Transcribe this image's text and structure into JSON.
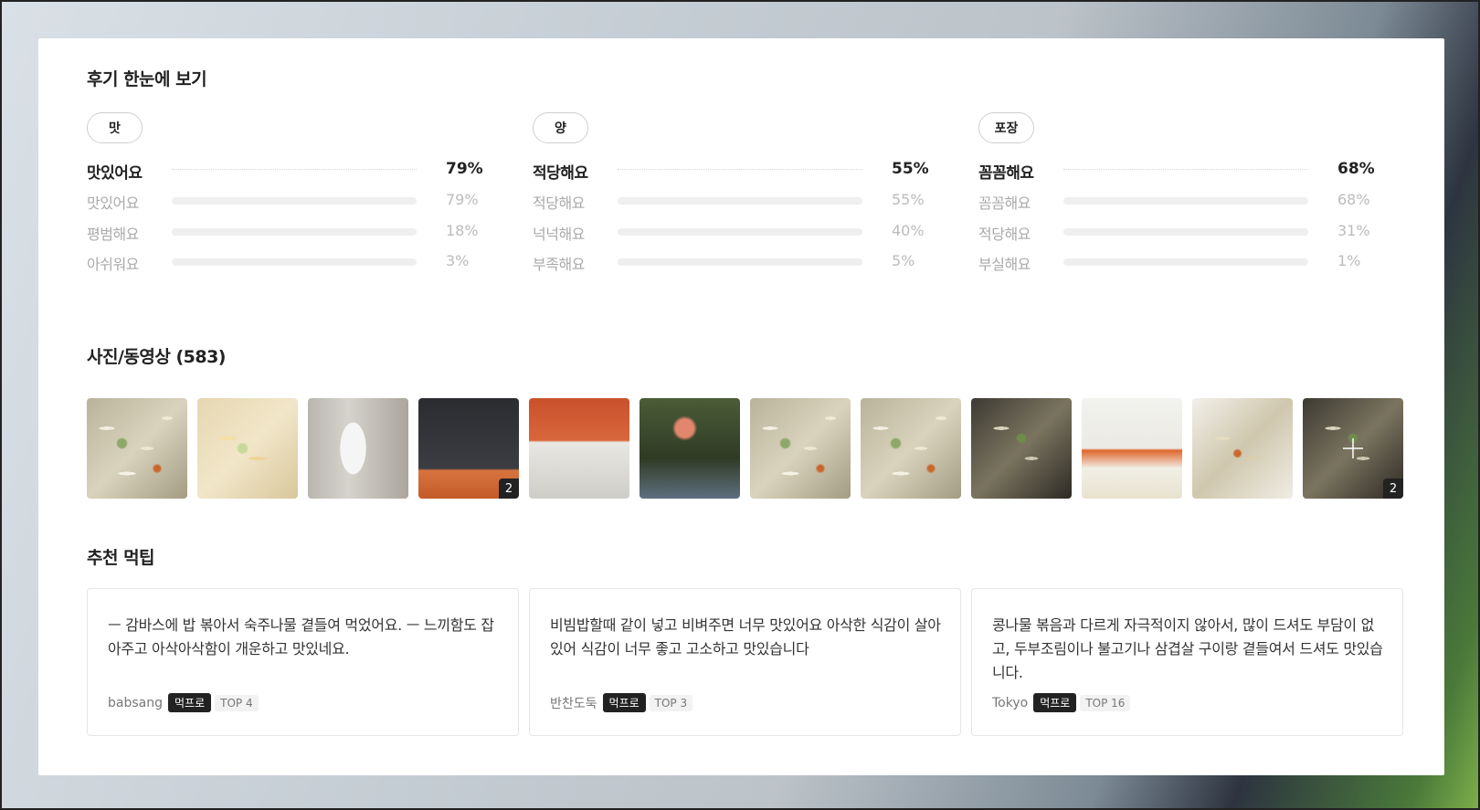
{
  "summary": {
    "title": "후기 한눈에 보기",
    "columns": [
      {
        "pill": "맛",
        "top_label": "맛있어요",
        "top_pct": "79%",
        "rows": [
          {
            "label": "맛있어요",
            "pct": "79%",
            "value": 79
          },
          {
            "label": "평범해요",
            "pct": "18%",
            "value": 18
          },
          {
            "label": "아쉬워요",
            "pct": "3%",
            "value": 3
          }
        ]
      },
      {
        "pill": "양",
        "top_label": "적당해요",
        "top_pct": "55%",
        "rows": [
          {
            "label": "적당해요",
            "pct": "55%",
            "value": 55
          },
          {
            "label": "넉넉해요",
            "pct": "40%",
            "value": 40
          },
          {
            "label": "부족해요",
            "pct": "5%",
            "value": 5
          }
        ]
      },
      {
        "pill": "포장",
        "top_label": "꼼꼼해요",
        "top_pct": "68%",
        "rows": [
          {
            "label": "꼼꼼해요",
            "pct": "68%",
            "value": 68
          },
          {
            "label": "적당해요",
            "pct": "31%",
            "value": 31
          },
          {
            "label": "부실해요",
            "pct": "1%",
            "value": 1
          }
        ]
      }
    ]
  },
  "photos": {
    "title": "사진/동영상 (583)",
    "thumbs": [
      {
        "style": "sprouts",
        "badge": ""
      },
      {
        "style": "noodle",
        "badge": ""
      },
      {
        "style": "label-pack",
        "badge": ""
      },
      {
        "style": "black-tray",
        "badge": "2"
      },
      {
        "style": "orange-lids",
        "badge": ""
      },
      {
        "style": "flower",
        "badge": ""
      },
      {
        "style": "sprouts",
        "badge": ""
      },
      {
        "style": "sprouts",
        "badge": ""
      },
      {
        "style": "dark-sprouts",
        "badge": ""
      },
      {
        "style": "banchan",
        "badge": ""
      },
      {
        "style": "white-box",
        "badge": ""
      },
      {
        "style": "dark-sprouts",
        "badge": "2",
        "more": true
      }
    ],
    "more_icon": "plus-icon"
  },
  "tips": {
    "title": "추천 먹팁",
    "items": [
      {
        "text": "ㅡ 감바스에 밥 볶아서 숙주나물 곁들여 먹었어요. ㅡ 느끼함도 잡아주고 아삭아삭함이 개운하고 맛있네요.",
        "author": "babsang",
        "badge": "먹프로",
        "rank": "TOP 4"
      },
      {
        "text": "비빔밥할때 같이 넣고 비벼주면 너무 맛있어요 아삭한 식감이 살아있어 식감이 너무 좋고 고소하고 맛있습니다",
        "author": "반찬도둑",
        "badge": "먹프로",
        "rank": "TOP 3"
      },
      {
        "text": "콩나물 볶음과 다르게 자극적이지 않아서, 많이 드셔도 부담이 없고, 두부조림이나 불고기나 삼겹살 구이랑 곁들여서 드셔도 맛있습니다.",
        "author": "Tokyo",
        "badge": "먹프로",
        "rank": "TOP 16"
      }
    ]
  }
}
